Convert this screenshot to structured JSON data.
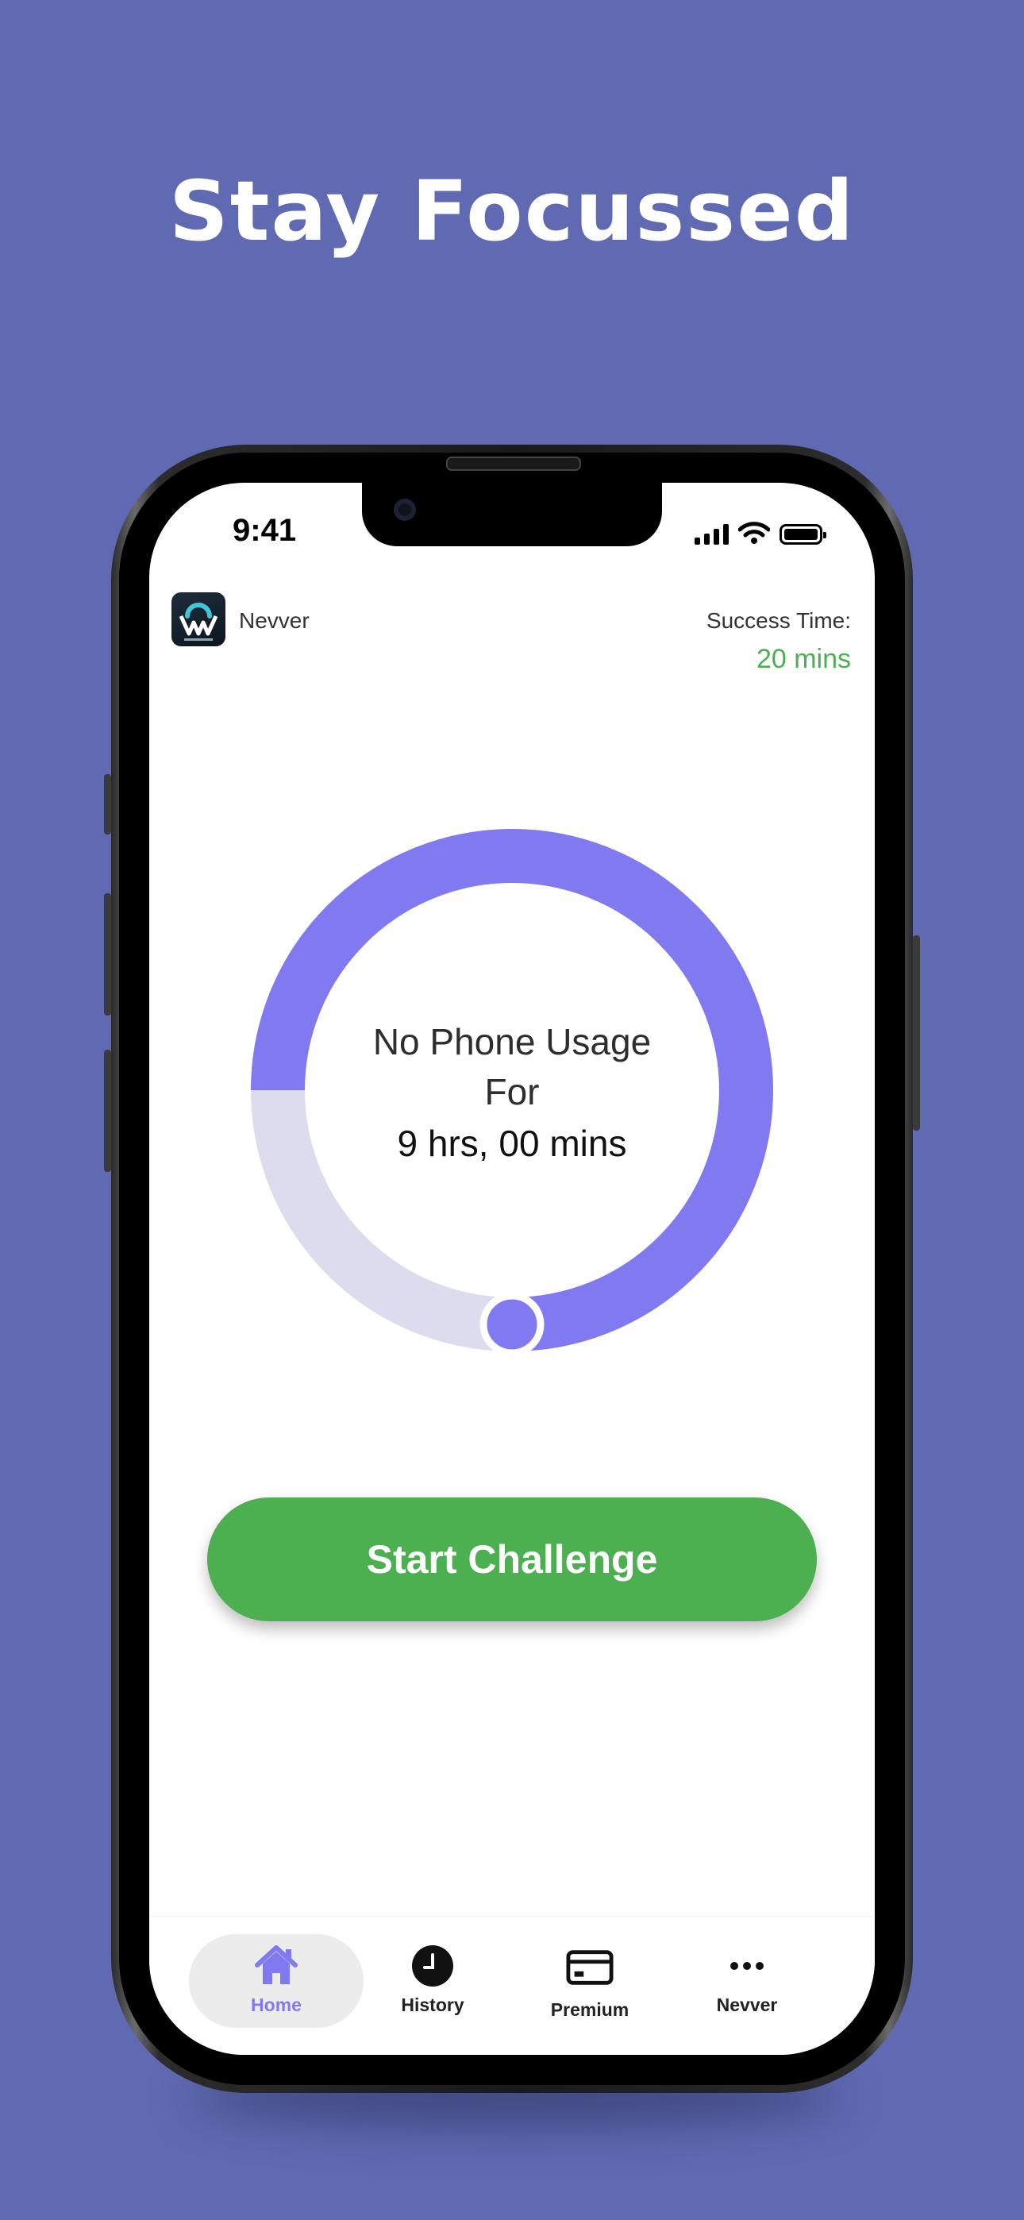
{
  "headline": "Stay Focussed",
  "status_bar": {
    "time": "9:41"
  },
  "app": {
    "name": "Nevver",
    "success_label": "Success Time:",
    "success_value": "20 mins"
  },
  "timer": {
    "line1": "No Phone Usage",
    "line2": "For",
    "line3": "9 hrs, 00 mins",
    "progress_fraction": 0.75
  },
  "start_button": "Start Challenge",
  "tabs": [
    {
      "label": "Home",
      "icon": "home-icon",
      "active": true
    },
    {
      "label": "History",
      "icon": "clock-icon",
      "active": false
    },
    {
      "label": "Premium",
      "icon": "card-icon",
      "active": false
    },
    {
      "label": "Nevver",
      "icon": "more-icon",
      "active": false
    }
  ],
  "colors": {
    "background": "#5F6AB2",
    "ring_active": "#8179EF",
    "ring_track": "#DDDCEF",
    "accent_green": "#4CAF50",
    "active_tab": "#8179EF"
  }
}
